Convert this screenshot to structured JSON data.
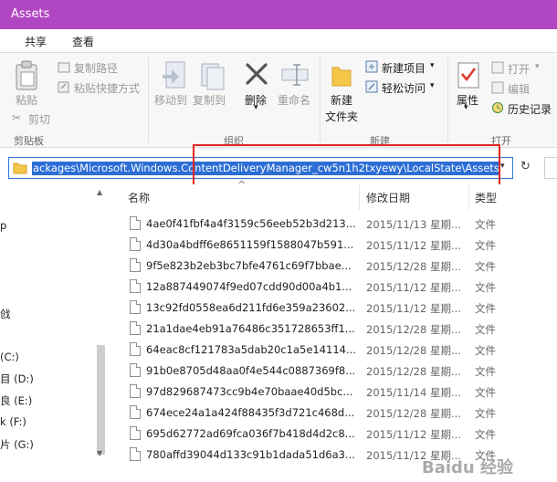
{
  "window": {
    "title": "Assets"
  },
  "tabs": [
    "共享",
    "查看"
  ],
  "ribbon": {
    "clipboard": {
      "paste": "粘贴",
      "cut": "剪切",
      "copy_path": "复制路径",
      "paste_shortcut": "粘贴快捷方式",
      "group_label": "剪贴板"
    },
    "organize": {
      "move_to": "移动到",
      "copy_to": "复制到",
      "delete": "删除",
      "rename": "重命名",
      "group_label": "组织"
    },
    "new": {
      "new_folder_line1": "新建",
      "new_folder_line2": "文件夹",
      "new_item": "新建项目",
      "easy_access": "轻松访问",
      "group_label": "新建"
    },
    "open": {
      "properties": "属性",
      "open": "打开",
      "edit": "编辑",
      "history": "历史记录",
      "group_label": "打开"
    }
  },
  "address": {
    "path": "ackages\\Microsoft.Windows.ContentDeliveryManager_cw5n1h2txyewy\\LocalState\\Assets"
  },
  "nav": {
    "items": [
      "p",
      "戗",
      "(C:)",
      "目 (D:)",
      "良 (E:)",
      "k (F:)",
      "片 (G:)"
    ]
  },
  "columns": {
    "name": "名称",
    "date": "修改日期",
    "type": "类型"
  },
  "files": [
    {
      "name": "4ae0f41fbf4a4f3159c56eeb52b3d213...",
      "date": "2015/11/13 星期...",
      "type": "文件"
    },
    {
      "name": "4d30a4bdff6e8651159f1588047b591...",
      "date": "2015/11/12 星期...",
      "type": "文件"
    },
    {
      "name": "9f5e823b2eb3bc7bfe4761c69f7bbae...",
      "date": "2015/12/28 星期...",
      "type": "文件"
    },
    {
      "name": "12a887449074f9ed07cdd90d00a4b1...",
      "date": "2015/11/12 星期...",
      "type": "文件"
    },
    {
      "name": "13c92fd0558ea6d211fd6e359a23602...",
      "date": "2015/11/12 星期...",
      "type": "文件"
    },
    {
      "name": "21a1dae4eb91a76486c351728653ff1...",
      "date": "2015/12/28 星期...",
      "type": "文件"
    },
    {
      "name": "64eac8cf121783a5dab20c1a5e14114...",
      "date": "2015/12/28 星期...",
      "type": "文件"
    },
    {
      "name": "91b0e8705d48aa0f4e544c0887369f8...",
      "date": "2015/12/28 星期...",
      "type": "文件"
    },
    {
      "name": "97d829687473cc9b4e70baae40d5bc...",
      "date": "2015/11/14 星期...",
      "type": "文件"
    },
    {
      "name": "674ece24a1a424f88435f3d721c468d...",
      "date": "2015/12/28 星期...",
      "type": "文件"
    },
    {
      "name": "695d62772ad69fca036f7b418d4d2c8...",
      "date": "2015/11/12 星期...",
      "type": "文件"
    },
    {
      "name": "780affd39044d133c91b1dada51d6a3...",
      "date": "2015/11/12 星期...",
      "type": "文件"
    }
  ],
  "watermark": "Baidu 经验",
  "colors": {
    "titlebar": "#b146c2",
    "selection": "#2c6ed5",
    "highlight": "#e02525"
  }
}
